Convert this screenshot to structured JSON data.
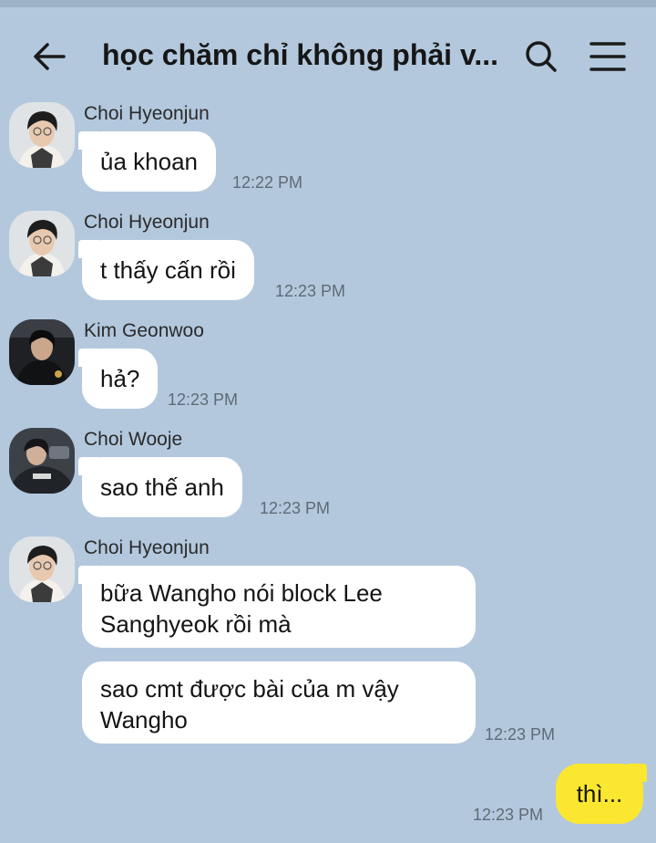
{
  "header": {
    "title": "học chăm chỉ không phải v...",
    "back_icon": "arrow-left-icon",
    "search_icon": "search-icon",
    "menu_icon": "hamburger-menu-icon"
  },
  "messages": [
    {
      "sender": "Choi Hyeonjun",
      "text": "ủa khoan",
      "time": "12:22 PM"
    },
    {
      "sender": "Choi Hyeonjun",
      "text": "t thấy cấn rồi",
      "time": "12:23 PM"
    },
    {
      "sender": "Kim Geonwoo",
      "text": "hả?",
      "time": "12:23 PM"
    },
    {
      "sender": "Choi Wooje",
      "text": "sao thế anh",
      "time": "12:23 PM"
    },
    {
      "sender": "Choi Hyeonjun",
      "text_line1": "bữa Wangho nói block Lee",
      "text_line2": "Sanghyeok rồi mà",
      "text2_line1": "sao cmt được bài của m vậy",
      "text2_line2": "Wangho",
      "time": "12:23 PM"
    }
  ],
  "my_message": {
    "text": "thì...",
    "time": "12:23 PM"
  },
  "colors": {
    "background": "#b3c8dd",
    "my_bubble": "#fbe630",
    "other_bubble": "#ffffff"
  }
}
